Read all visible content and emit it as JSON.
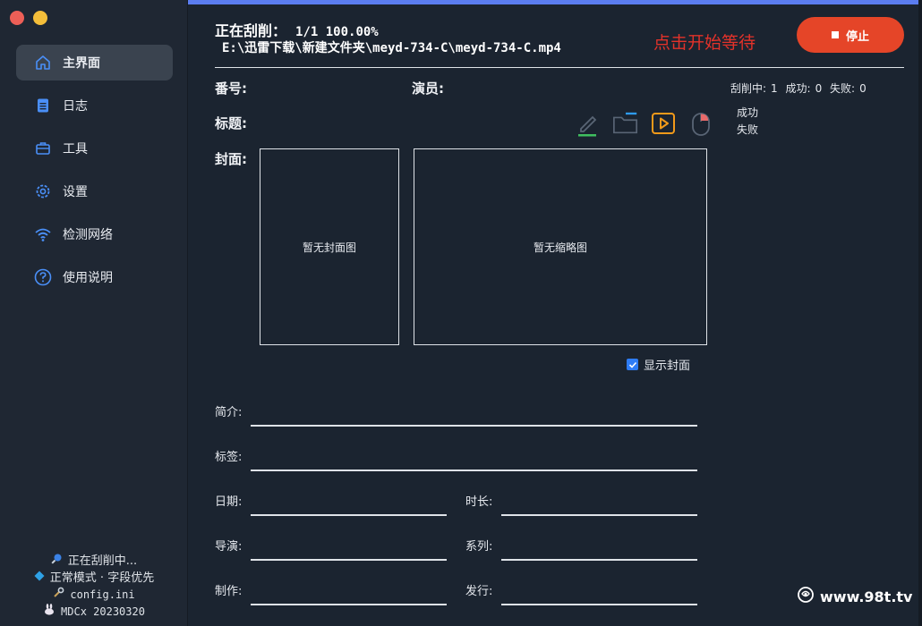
{
  "sidebar": {
    "nav": [
      {
        "label": "主界面",
        "icon": "home-icon",
        "active": true
      },
      {
        "label": "日志",
        "icon": "log-file-icon",
        "active": false
      },
      {
        "label": "工具",
        "icon": "toolbox-icon",
        "active": false
      },
      {
        "label": "设置",
        "icon": "gear-icon",
        "active": false
      },
      {
        "label": "检测网络",
        "icon": "wifi-icon",
        "active": false
      },
      {
        "label": "使用说明",
        "icon": "help-icon",
        "active": false
      }
    ],
    "status": {
      "scraping": "正在刮削中...",
      "mode": "正常模式 · 字段优先",
      "config": "config.ini",
      "version": "MDCx 20230320"
    }
  },
  "header": {
    "progress_label": "正在刮削：",
    "progress_value": "1/1 100.00%",
    "file_path": "E:\\迅雷下载\\新建文件夹\\meyd-734-C\\meyd-734-C.mp4",
    "hint": "点击开始等待",
    "stop_label": "停止"
  },
  "info": {
    "number_label": "番号:",
    "actor_label": "演员:",
    "title_label": "标题:",
    "cover_label": "封面:",
    "stats": {
      "scraping_label": "刮削中:",
      "scraping_count": "1",
      "success_label": "成功:",
      "success_count": "0",
      "fail_label": "失败:",
      "fail_count": "0"
    },
    "results": [
      "成功",
      "失败"
    ],
    "cover_placeholder": "暂无封面图",
    "thumb_placeholder": "暂无缩略图",
    "show_cover_label": "显示封面"
  },
  "fields": {
    "intro": "简介:",
    "tags": "标签:",
    "date": "日期:",
    "duration": "时长:",
    "director": "导演:",
    "series": "系列:",
    "studio": "制作:",
    "publisher": "发行:"
  },
  "watermark": "www.98t.tv",
  "colors": {
    "accent": "#5b7df0",
    "stop": "#e54528",
    "hint": "#e3322a",
    "bg": "#1b2430"
  }
}
